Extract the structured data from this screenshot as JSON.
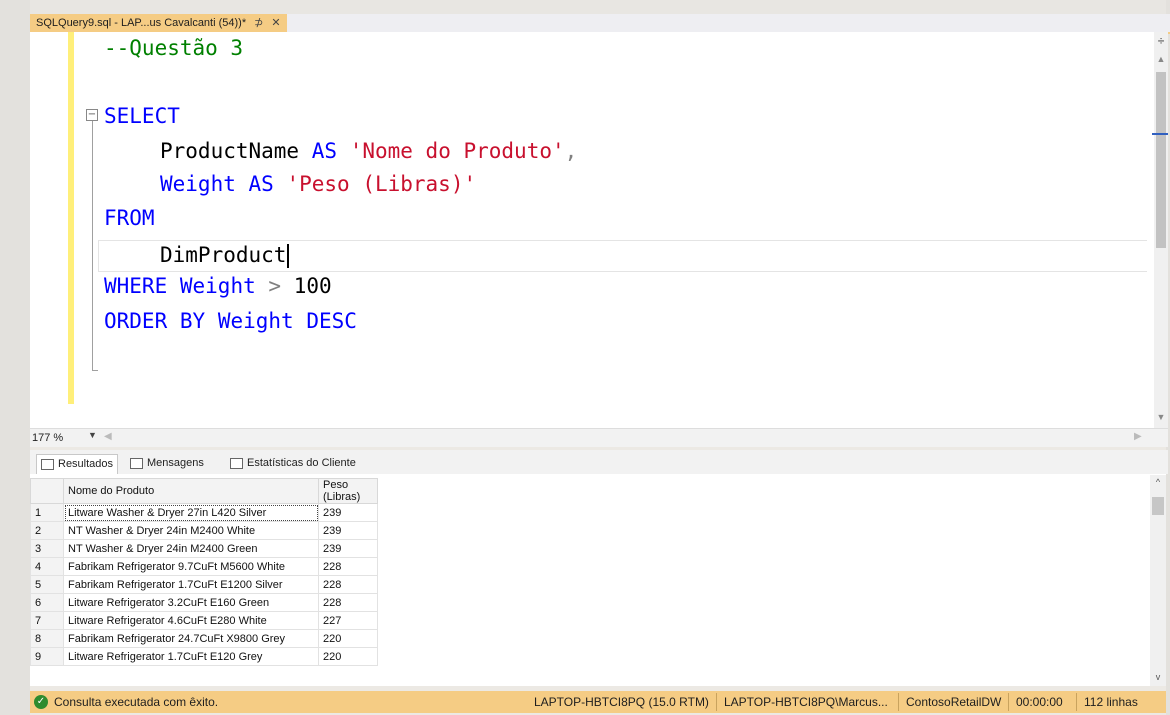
{
  "document_tab": {
    "title": "SQLQuery9.sql - LAP...us Cavalcanti (54))*",
    "pin": "⊅",
    "close": "✕"
  },
  "editor": {
    "lines": {
      "comment": "--Questão 3",
      "select": "SELECT",
      "col1_name": "ProductName",
      "col1_as": "AS",
      "col1_alias": "'Nome do Produto'",
      "col1_comma": ",",
      "col2_name": "Weight",
      "col2_as": "AS",
      "col2_alias": "'Peso (Libras)'",
      "from": "FROM",
      "table": "DimProduct",
      "where_kw": "WHERE",
      "where_col": "Weight",
      "where_op": ">",
      "where_val": "100",
      "order_kw": "ORDER BY",
      "order_col": "Weight",
      "order_dir": "DESC"
    }
  },
  "zoom": {
    "level": "177 %"
  },
  "result_tabs": [
    {
      "label": "Resultados"
    },
    {
      "label": "Mensagens"
    },
    {
      "label": "Estatísticas do Cliente"
    }
  ],
  "results": {
    "columns": [
      "Nome do Produto",
      "Peso (Libras)"
    ],
    "rows": [
      [
        "1",
        "Litware Washer & Dryer 27in L420 Silver",
        "239"
      ],
      [
        "2",
        "NT Washer & Dryer 24in M2400 White",
        "239"
      ],
      [
        "3",
        "NT Washer & Dryer 24in M2400 Green",
        "239"
      ],
      [
        "4",
        "Fabrikam Refrigerator 9.7CuFt M5600 White",
        "228"
      ],
      [
        "5",
        "Fabrikam Refrigerator 1.7CuFt E1200 Silver",
        "228"
      ],
      [
        "6",
        "Litware Refrigerator 3.2CuFt E160 Green",
        "228"
      ],
      [
        "7",
        "Litware Refrigerator 4.6CuFt E280 White",
        "227"
      ],
      [
        "8",
        "Fabrikam Refrigerator 24.7CuFt X9800 Grey",
        "220"
      ],
      [
        "9",
        "Litware Refrigerator 1.7CuFt E120 Grey",
        "220"
      ]
    ]
  },
  "status": {
    "message": "Consulta executada com êxito.",
    "server": "LAPTOP-HBTCI8PQ (15.0 RTM)",
    "user": "LAPTOP-HBTCI8PQ\\Marcus...",
    "database": "ContosoRetailDW",
    "elapsed": "00:00:00",
    "rows": "112 linhas"
  },
  "colors": {
    "accent": "#f5cc84",
    "keyword": "#0000ff",
    "string": "#c8102e",
    "comment": "#008000"
  }
}
